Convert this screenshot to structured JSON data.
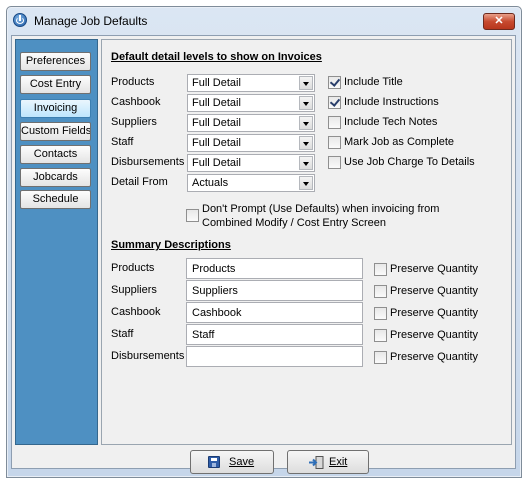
{
  "window": {
    "title": "Manage Job Defaults",
    "close_glyph": "✕"
  },
  "sidebar": {
    "items": [
      {
        "label": "Preferences",
        "active": false
      },
      {
        "label": "Cost Entry",
        "active": false
      },
      {
        "label": "Invoicing",
        "active": true
      },
      {
        "label": "Custom Fields",
        "active": false
      },
      {
        "label": "Contacts",
        "active": false
      },
      {
        "label": "Jobcards",
        "active": false
      },
      {
        "label": "Schedule",
        "active": false
      }
    ]
  },
  "detail": {
    "heading": "Default detail levels to show on Invoices",
    "rows": [
      {
        "label": "Products",
        "value": "Full Detail"
      },
      {
        "label": "Cashbook",
        "value": "Full Detail"
      },
      {
        "label": "Suppliers",
        "value": "Full Detail"
      },
      {
        "label": "Staff",
        "value": "Full Detail"
      },
      {
        "label": "Disbursements",
        "value": "Full Detail"
      },
      {
        "label": "Detail From",
        "value": "Actuals"
      }
    ],
    "options": [
      {
        "label": "Include Title",
        "checked": true
      },
      {
        "label": "Include Instructions",
        "checked": true
      },
      {
        "label": "Include Tech Notes",
        "checked": false
      },
      {
        "label": "Mark Job as Complete",
        "checked": false
      },
      {
        "label": "Use Job Charge To Details",
        "checked": false
      }
    ],
    "dont_prompt": {
      "line1": "Don't Prompt (Use Defaults) when invoicing from",
      "line2": "Combined Modify / Cost Entry Screen",
      "checked": false
    }
  },
  "summary": {
    "heading": "Summary Descriptions",
    "rows": [
      {
        "label": "Products",
        "value": "Products",
        "preserve_label": "Preserve Quantity",
        "preserve_checked": false
      },
      {
        "label": "Suppliers",
        "value": "Suppliers",
        "preserve_label": "Preserve Quantity",
        "preserve_checked": false
      },
      {
        "label": "Cashbook",
        "value": "Cashbook",
        "preserve_label": "Preserve Quantity",
        "preserve_checked": false
      },
      {
        "label": "Staff",
        "value": "Staff",
        "preserve_label": "Preserve Quantity",
        "preserve_checked": false
      },
      {
        "label": "Disbursements",
        "value": "",
        "preserve_label": "Preserve Quantity",
        "preserve_checked": false
      }
    ]
  },
  "footer": {
    "save_label": "Save",
    "exit_label": "Exit"
  },
  "colors": {
    "sidebar": "#4e90c2",
    "titlebar": "#c6d6ea",
    "close": "#c74a2f"
  }
}
